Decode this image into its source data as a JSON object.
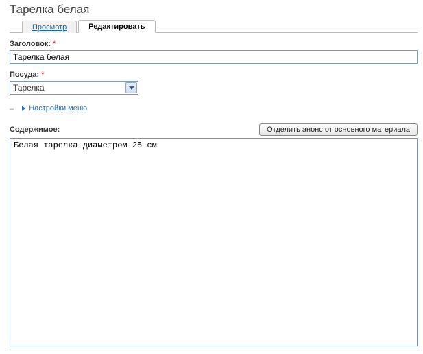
{
  "page_title": "Тарелка белая",
  "tabs": {
    "view": "Просмотр",
    "edit": "Редактировать"
  },
  "form": {
    "title_label": "Заголовок:",
    "title_value": "Тарелка белая",
    "category_label": "Посуда:",
    "category_selected": "Тарелка",
    "required_mark": "*"
  },
  "fieldset": {
    "menu_settings": "Настройки меню"
  },
  "content": {
    "label": "Содержимое:",
    "split_button": "Отделить анонс от основного материала",
    "body": "Белая тарелка диаметром 25 см"
  }
}
